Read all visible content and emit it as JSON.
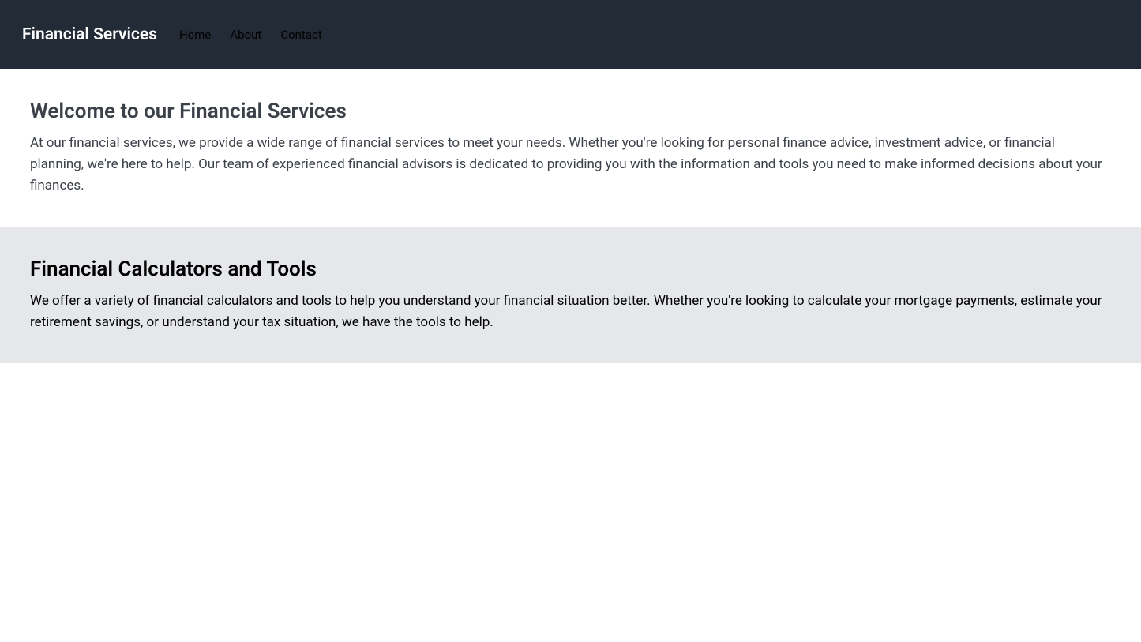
{
  "navbar": {
    "brand": "Financial Services",
    "links": {
      "home": "Home",
      "about": "About",
      "contact": "Contact"
    }
  },
  "section1": {
    "title": "Welcome to our Financial Services",
    "text": "At our financial services, we provide a wide range of financial services to meet your needs. Whether you're looking for personal finance advice, investment advice, or financial planning, we're here to help. Our team of experienced financial advisors is dedicated to providing you with the information and tools you need to make informed decisions about your finances."
  },
  "section2": {
    "title": "Financial Calculators and Tools",
    "text": "We offer a variety of financial calculators and tools to help you understand your financial situation better. Whether you're looking to calculate your mortgage payments, estimate your retirement savings, or understand your tax situation, we have the tools to help."
  }
}
